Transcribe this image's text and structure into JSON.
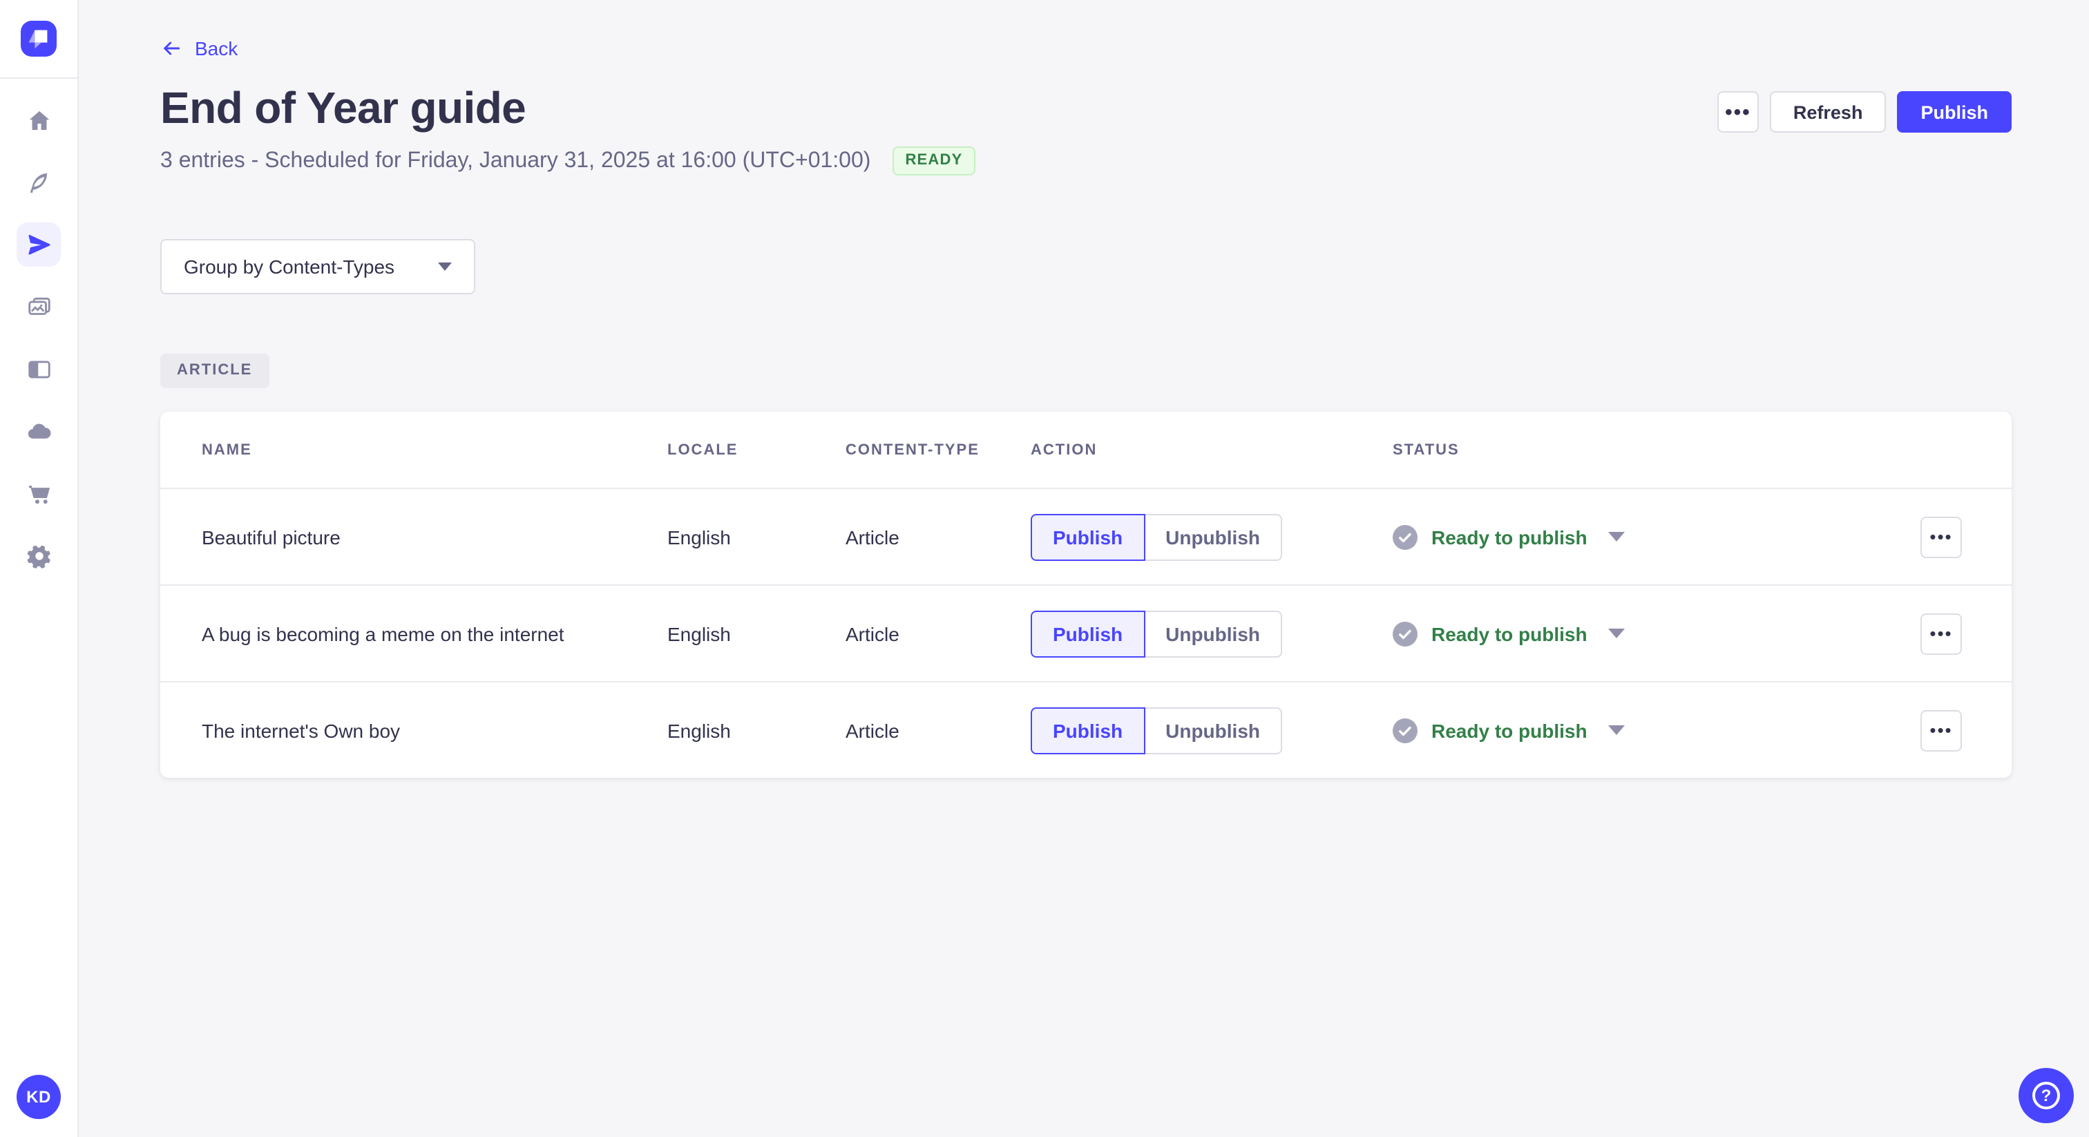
{
  "app": {
    "name": "Strapi admin — Releases"
  },
  "colors": {
    "accent": "#4945ff",
    "accent_light": "#f0f0ff",
    "success_text": "#328048",
    "success_bg": "#eafbe7",
    "success_border": "#c6f0c2",
    "text_primary": "#32324d",
    "text_muted": "#666687",
    "border": "#dcdce4",
    "page_bg": "#f6f6f9"
  },
  "icons": {
    "ellipsis": "•••",
    "question_mark": "?"
  },
  "sidebar": {
    "logo": "strapi-logo",
    "avatar_initials": "KD",
    "items": [
      {
        "icon": "home-icon",
        "active": false
      },
      {
        "icon": "content-manager-feather-icon",
        "active": false
      },
      {
        "icon": "releases-paper-plane-icon",
        "active": true
      },
      {
        "icon": "media-library-images-icon",
        "active": false
      },
      {
        "icon": "content-type-builder-layout-icon",
        "active": false
      },
      {
        "icon": "cloud-icon",
        "active": false
      },
      {
        "icon": "marketplace-cart-icon",
        "active": false
      },
      {
        "icon": "settings-gear-icon",
        "active": false
      }
    ]
  },
  "header": {
    "back_label": "Back",
    "title": "End of Year guide",
    "subtitle": "3 entries - Scheduled for Friday, January 31, 2025 at 16:00 (UTC+01:00)",
    "status_badge": "READY",
    "refresh_label": "Refresh",
    "publish_label": "Publish"
  },
  "toolbar": {
    "group_by_label": "Group by Content-Types"
  },
  "group": {
    "label": "ARTICLE"
  },
  "table": {
    "headers": [
      "NAME",
      "LOCALE",
      "CONTENT-TYPE",
      "ACTION",
      "STATUS"
    ],
    "action_labels": {
      "publish": "Publish",
      "unpublish": "Unpublish"
    },
    "rows": [
      {
        "name": "Beautiful picture",
        "locale": "English",
        "content_type": "Article",
        "status": "Ready to publish"
      },
      {
        "name": "A bug is becoming a meme on the internet",
        "locale": "English",
        "content_type": "Article",
        "status": "Ready to publish"
      },
      {
        "name": "The internet's Own boy",
        "locale": "English",
        "content_type": "Article",
        "status": "Ready to publish"
      }
    ]
  }
}
